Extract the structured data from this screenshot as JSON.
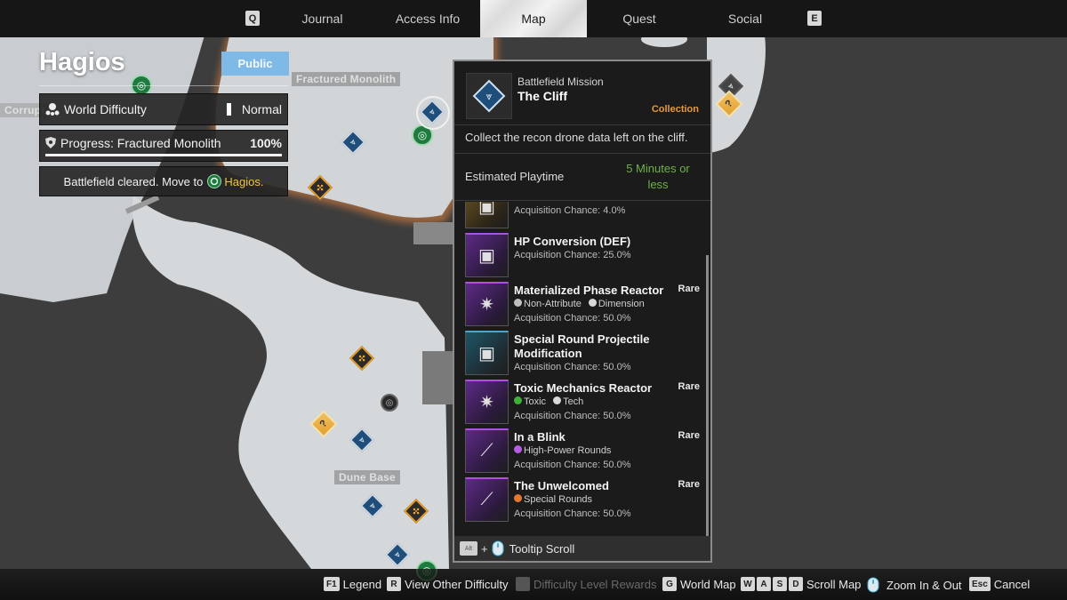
{
  "topnav": {
    "prev_key": "Q",
    "next_key": "E",
    "tabs": [
      {
        "label": "Journal",
        "active": false
      },
      {
        "label": "Access Info",
        "active": false
      },
      {
        "label": "Map",
        "active": true
      },
      {
        "label": "Quest",
        "active": false
      },
      {
        "label": "Social",
        "active": false
      }
    ]
  },
  "region": {
    "title": "Hagios",
    "visibility_badge": "Public"
  },
  "info_panel": {
    "difficulty_label": "World Difficulty",
    "difficulty_value": "Normal",
    "progress_label": "Progress: Fractured Monolith",
    "progress_value": "100%",
    "progress_fraction": 1.0,
    "cleared_text": "Battlefield cleared. Move to",
    "cleared_destination": "Hagios."
  },
  "map_labels": {
    "fractured_monolith": "Fractured Monolith",
    "dune_base": "Dune Base",
    "corrupt": "Corrupt"
  },
  "tooltip": {
    "category": "Battlefield Mission",
    "title": "The Cliff",
    "type": "Collection",
    "description": "Collect the recon drone data left on the cliff.",
    "playtime_label": "Estimated Playtime",
    "playtime_value": "5 Minutes or less",
    "rewards": [
      {
        "name": "",
        "rarity": "",
        "attributes": [],
        "chance": "Acquisition Chance: 4.0%",
        "frame": "gold",
        "icon": "mod-icon"
      },
      {
        "name": "HP Conversion (DEF)",
        "rarity": "",
        "attributes": [],
        "chance": "Acquisition Chance: 25.0%",
        "frame": "purple",
        "icon": "mod-icon"
      },
      {
        "name": "Materialized Phase Reactor",
        "rarity": "Rare",
        "attributes": [
          {
            "label": "Non-Attribute",
            "color": "#bfbfbf"
          },
          {
            "label": "Dimension",
            "color": "#d8d8d8"
          }
        ],
        "chance": "Acquisition Chance: 50.0%",
        "frame": "purple",
        "icon": "reactor-icon"
      },
      {
        "name": "Special Round Projectile Modification",
        "rarity": "",
        "attributes": [],
        "chance": "Acquisition Chance: 50.0%",
        "frame": "teal",
        "icon": "mod-icon"
      },
      {
        "name": "Toxic Mechanics Reactor",
        "rarity": "Rare",
        "attributes": [
          {
            "label": "Toxic",
            "color": "#3fae3a"
          },
          {
            "label": "Tech",
            "color": "#d8d8d8"
          }
        ],
        "chance": "Acquisition Chance: 50.0%",
        "frame": "purple",
        "icon": "reactor-icon"
      },
      {
        "name": "In a Blink",
        "rarity": "Rare",
        "attributes": [
          {
            "label": "High-Power Rounds",
            "color": "#b55ce0"
          }
        ],
        "chance": "Acquisition Chance: 50.0%",
        "frame": "purple",
        "icon": "weapon-icon"
      },
      {
        "name": "The Unwelcomed",
        "rarity": "Rare",
        "attributes": [
          {
            "label": "Special Rounds",
            "color": "#e5782e"
          }
        ],
        "chance": "Acquisition Chance: 50.0%",
        "frame": "purple",
        "icon": "weapon-icon"
      }
    ],
    "footer_key": "Alt",
    "footer_plus": "+",
    "footer_label": "Tooltip Scroll"
  },
  "hints": [
    {
      "keys": [
        "F1"
      ],
      "label": "Legend",
      "enabled": true
    },
    {
      "keys": [
        "R"
      ],
      "label": "View Other Difficulty",
      "enabled": true
    },
    {
      "keys": [
        "F"
      ],
      "label": "Difficulty Level Rewards",
      "enabled": false
    },
    {
      "keys": [
        "G"
      ],
      "label": "World Map",
      "enabled": true
    },
    {
      "keys": [
        "W",
        "A",
        "S",
        "D"
      ],
      "label": "Scroll Map",
      "enabled": true
    },
    {
      "keys": [],
      "label": "Zoom In & Out",
      "enabled": true,
      "icon": "mouse-wheel-icon"
    },
    {
      "keys": [
        "Esc"
      ],
      "label": "Cancel",
      "enabled": true
    }
  ],
  "colors": {
    "accent_orange": "#e49a3c",
    "playtime_green": "#6fb04a",
    "destination_yellow": "#f0c43a",
    "public_blue": "#7fb9e6",
    "rare_purple": "#b04fe0"
  }
}
